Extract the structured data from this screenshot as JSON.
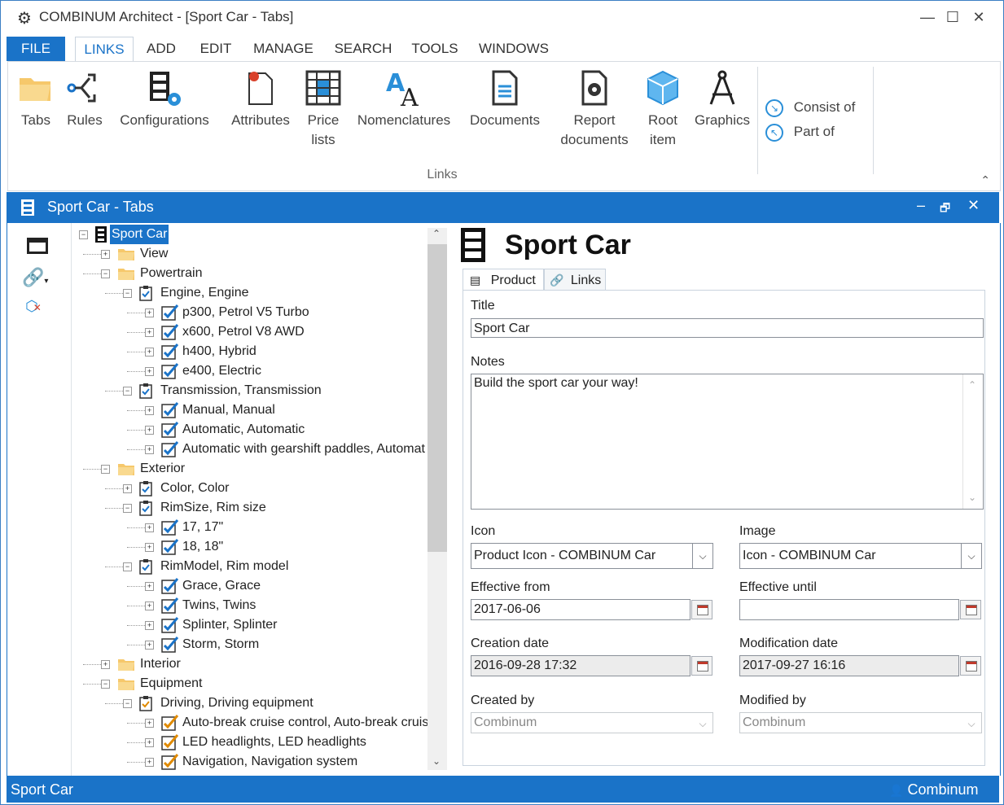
{
  "app": {
    "title": "COMBINUM Architect - [Sport Car - Tabs]",
    "window_buttons": [
      "—",
      "☐",
      "✕"
    ]
  },
  "ribbon_tabs": [
    "FILE",
    "LINKS",
    "ADD",
    "EDIT",
    "MANAGE",
    "SEARCH",
    "TOOLS",
    "WINDOWS"
  ],
  "ribbon": {
    "buttons": [
      {
        "label": "Tabs"
      },
      {
        "label": "Rules"
      },
      {
        "label": "Configurations"
      },
      {
        "label": "Attributes"
      },
      {
        "label_line1": "Price",
        "label_line2": "lists"
      },
      {
        "label": "Nomenclatures"
      },
      {
        "label": "Documents"
      },
      {
        "label_line1": "Report",
        "label_line2": "documents"
      },
      {
        "label_line1": "Root",
        "label_line2": "item"
      },
      {
        "label": "Graphics"
      }
    ],
    "small_buttons": [
      "Consist of",
      "Part of"
    ],
    "group_label": "Links",
    "collapse": "⌃"
  },
  "document": {
    "title": "Sport Car - Tabs",
    "buttons": [
      "‒",
      "🗗",
      "✕"
    ]
  },
  "tree": [
    {
      "label": "Sport Car",
      "selected": true
    },
    {
      "label": "View"
    },
    {
      "label": "Powertrain"
    },
    {
      "label": "Engine, Engine"
    },
    {
      "label": "p300, Petrol V5 Turbo"
    },
    {
      "label": "x600, Petrol V8 AWD"
    },
    {
      "label": "h400, Hybrid"
    },
    {
      "label": "e400, Electric"
    },
    {
      "label": "Transmission, Transmission"
    },
    {
      "label": "Manual, Manual"
    },
    {
      "label": "Automatic, Automatic"
    },
    {
      "label": "Automatic with gearshift paddles, Automat"
    },
    {
      "label": "Exterior"
    },
    {
      "label": "Color, Color"
    },
    {
      "label": "RimSize, Rim size"
    },
    {
      "label": "17, 17\""
    },
    {
      "label": "18, 18\""
    },
    {
      "label": "RimModel, Rim model"
    },
    {
      "label": "Grace, Grace"
    },
    {
      "label": "Twins, Twins"
    },
    {
      "label": "Splinter, Splinter"
    },
    {
      "label": "Storm, Storm"
    },
    {
      "label": "Interior"
    },
    {
      "label": "Equipment"
    },
    {
      "label": "Driving, Driving equipment"
    },
    {
      "label": "Auto-break cruise control, Auto-break cruis"
    },
    {
      "label": "LED headlights, LED headlights"
    },
    {
      "label": "Navigation, Navigation system"
    }
  ],
  "detail": {
    "heading": "Sport Car",
    "tabs": [
      "Product",
      "Links"
    ],
    "title_label": "Title",
    "title_value": "Sport Car",
    "notes_label": "Notes",
    "notes_value": "Build the sport car your way!",
    "icon_label": "Icon",
    "icon_value": "Product Icon - COMBINUM Car",
    "image_label": "Image",
    "image_value": "Icon - COMBINUM Car",
    "eff_from_label": "Effective from",
    "eff_from_value": "2017-06-06",
    "eff_until_label": "Effective until",
    "eff_until_value": "",
    "created_label": "Creation date",
    "created_value": "2016-09-28 17:32",
    "modified_label": "Modification date",
    "modified_value": "2017-09-27 16:16",
    "created_by_label": "Created by",
    "created_by_value": "Combinum",
    "modified_by_label": "Modified by",
    "modified_by_value": "Combinum"
  },
  "status": {
    "left": "Sport Car",
    "user": "Combinum"
  },
  "colors": {
    "accent": "#1a73c8",
    "check_blue": "#1a73c8",
    "check_orange": "#e08a00"
  }
}
